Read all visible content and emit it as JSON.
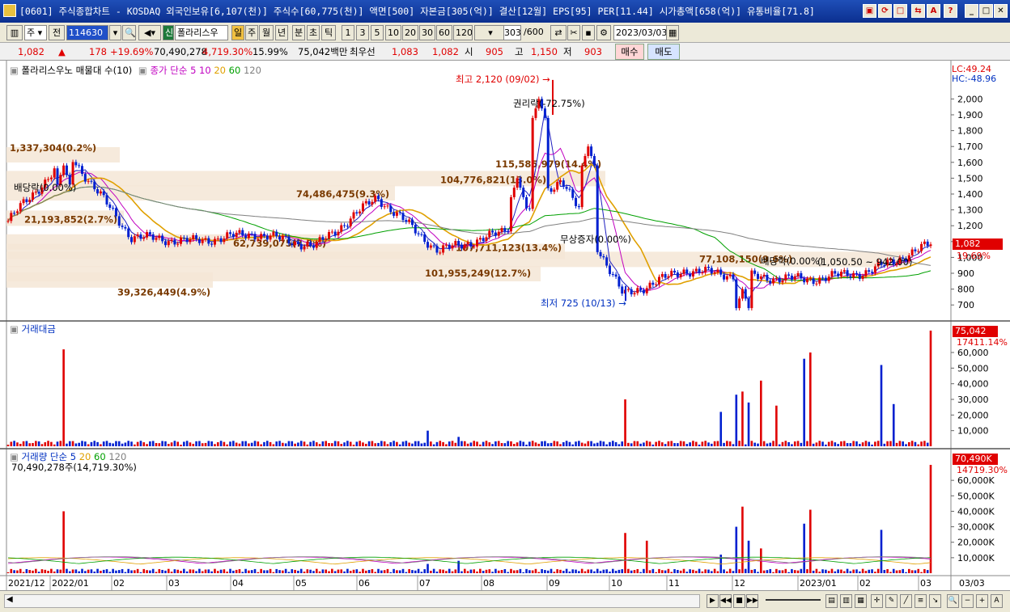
{
  "window": {
    "title": "[0601] 주식종합차트 - KOSDAQ 외국인보유[6,107(천)] 주식수[60,775(천)] 액면[500] 자본금[305(억)] 결산[12월] EPS[95] PER[11.44] 시가총액[658(억)] 유통비율[71.8]",
    "buttons": [
      "restore",
      "help",
      "settings",
      "a",
      "?",
      "minimize",
      "maximize",
      "close"
    ]
  },
  "toolbar": {
    "period_label": "주",
    "prev_label": "전",
    "code_value": "114630",
    "new_label": "신",
    "stock_name": "폴라리스우",
    "period_tabs": [
      "일",
      "주",
      "월",
      "년",
      "분",
      "초",
      "틱"
    ],
    "active_period": "일",
    "intervals": [
      "1",
      "3",
      "5",
      "10",
      "20",
      "30",
      "60",
      "120"
    ],
    "count_value": "303",
    "count_total": "/600",
    "date_value": "2023/03/03"
  },
  "quote": {
    "price": "1,082",
    "change": "178",
    "change_pct": "+19.69%",
    "volume": "70,490,278",
    "volume_pct": "4,719.30%",
    "turnover_pct": "15.99%",
    "amount": "75,042백만",
    "best_label": "최우선",
    "ask": "1,083",
    "bid": "1,082",
    "open_label": "시",
    "open": "905",
    "high_label": "고",
    "high": "1,150",
    "low_label": "저",
    "low": "903",
    "buy_label": "매수",
    "sell_label": "매도"
  },
  "panes": {
    "price": {
      "legend": "폴라리스우노 매물대 수(10)",
      "ma_legend": "종가 단순 5",
      "ma_periods": [
        "10",
        "20",
        "60",
        "120"
      ],
      "lc": "LC:49.24",
      "hc": "HC:-48.96",
      "last_price": "1,082",
      "last_pct": "19.69%",
      "annotations": {
        "high": "최고 2,120 (09/02)",
        "low": "최저 725 (10/13)",
        "rights": "권리락(-72.75%)",
        "dividend": "배당락(0.00%)",
        "bonus": "무상증자(0.00%)",
        "dividend2": "배당락(0.00%)",
        "range": "(1,050.50 ~ 942.00)"
      },
      "volume_profile": [
        "1,337,304(0.2%)",
        "115,585,979(14.4%)",
        "104,776,821(13.0%)",
        "74,486,475(9.3%)",
        "21,193,852(2.7%)",
        "62,739,075(7.8%)",
        "107,711,123(13.4%)",
        "101,955,249(12.7%)",
        "39,326,449(4.9%)",
        "77,108,150(9.6%)"
      ]
    },
    "amount": {
      "legend": "거래대금",
      "last": "75,042",
      "last_pct": "17411.14%"
    },
    "volume": {
      "legend": "거래량 단순 5",
      "ma_periods": [
        "20",
        "60",
        "120"
      ],
      "info": "70,490,278주(14,719.30%)",
      "last": "70,490K",
      "last_pct": "14719.30%"
    }
  },
  "x_axis": [
    "2021/12",
    "2022/01",
    "02",
    "03",
    "04",
    "05",
    "06",
    "07",
    "08",
    "09",
    "10",
    "11",
    "12",
    "2023/01",
    "02",
    "03",
    "03/03"
  ],
  "colors": {
    "up": "#e00000",
    "down": "#0020d0",
    "ma5": "#2020c0",
    "ma10": "#c000c0",
    "ma20": "#e0a000",
    "ma60": "#00a000",
    "ma120": "#808080"
  },
  "chart_data": [
    {
      "type": "candlestick",
      "title": "폴라리스우",
      "ylim": [
        650,
        2150
      ],
      "y_ticks": [
        700,
        800,
        900,
        1000,
        1100,
        1200,
        1300,
        1400,
        1500,
        1600,
        1700,
        1800,
        1900,
        2000
      ],
      "key_points": [
        {
          "date": "2021/12",
          "close": 1230
        },
        {
          "date": "2022/01",
          "close": 1650
        },
        {
          "date": "2022/02",
          "close": 1130
        },
        {
          "date": "2022/03",
          "close": 1100
        },
        {
          "date": "2022/04",
          "close": 1150
        },
        {
          "date": "2022/05",
          "close": 1070
        },
        {
          "date": "2022/06",
          "close": 1380
        },
        {
          "date": "2022/07",
          "close": 1040
        },
        {
          "date": "2022/08",
          "close": 1150
        },
        {
          "date": "2022/09",
          "close": 1500
        },
        {
          "date": "2022/10",
          "close": 760
        },
        {
          "date": "2022/11",
          "close": 920
        },
        {
          "date": "2022/12",
          "close": 880
        },
        {
          "date": "2023/01",
          "close": 860
        },
        {
          "date": "2023/02",
          "close": 910
        },
        {
          "date": "2023/03",
          "close": 1082
        }
      ]
    },
    {
      "type": "bar",
      "title": "거래대금",
      "ylim": [
        0,
        75000
      ],
      "y_ticks": [
        10000,
        20000,
        30000,
        40000,
        50000,
        60000
      ]
    },
    {
      "type": "bar",
      "title": "거래량",
      "ylim": [
        0,
        70000
      ],
      "y_ticks": [
        "10,000K",
        "20,000K",
        "30,000K",
        "40,000K",
        "50,000K",
        "60,000K"
      ]
    }
  ]
}
